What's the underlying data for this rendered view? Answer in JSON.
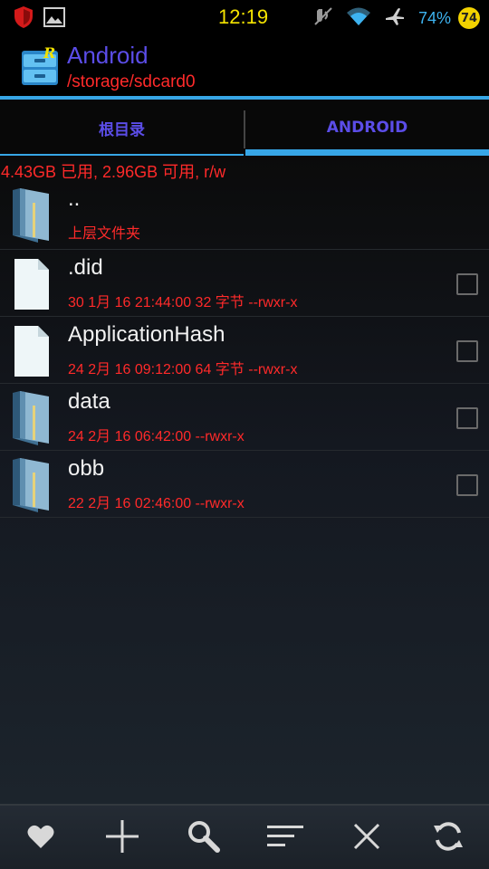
{
  "status_bar": {
    "clock": "12:19",
    "battery_percent": "74%",
    "badge_count": "74",
    "icons": [
      "shield-icon",
      "image-icon",
      "mute-icon",
      "wifi-icon",
      "airplane-icon"
    ]
  },
  "header": {
    "title": "Android",
    "path": "/storage/sdcard0",
    "app_icon": "file-manager-icon"
  },
  "tabs": [
    {
      "label": "根目录",
      "active": false
    },
    {
      "label": "ANDROID",
      "active": true
    }
  ],
  "storage_info": "4.43GB 已用, 2.96GB 可用, r/w",
  "files": [
    {
      "name": "..",
      "meta": "上层文件夹",
      "type": "folder",
      "checkbox": false
    },
    {
      "name": ".did",
      "meta": "30 1月 16 21:44:00  32 字节  --rwxr-x",
      "type": "file",
      "checkbox": true
    },
    {
      "name": "ApplicationHash",
      "meta": "24 2月 16 09:12:00  64 字节  --rwxr-x",
      "type": "file",
      "checkbox": true
    },
    {
      "name": "data",
      "meta": "24 2月 16 06:42:00     --rwxr-x",
      "type": "folder",
      "checkbox": true
    },
    {
      "name": "obb",
      "meta": "22 2月 16 02:46:00     --rwxr-x",
      "type": "folder",
      "checkbox": true
    }
  ],
  "toolbar": [
    "heart-icon",
    "plus-icon",
    "search-icon",
    "sort-icon",
    "close-icon",
    "refresh-icon"
  ],
  "colors": {
    "accent_blue": "#37a6e6",
    "title_purple": "#5b4de8",
    "meta_red": "#ff2a2a",
    "clock_yellow": "#f5e400"
  }
}
